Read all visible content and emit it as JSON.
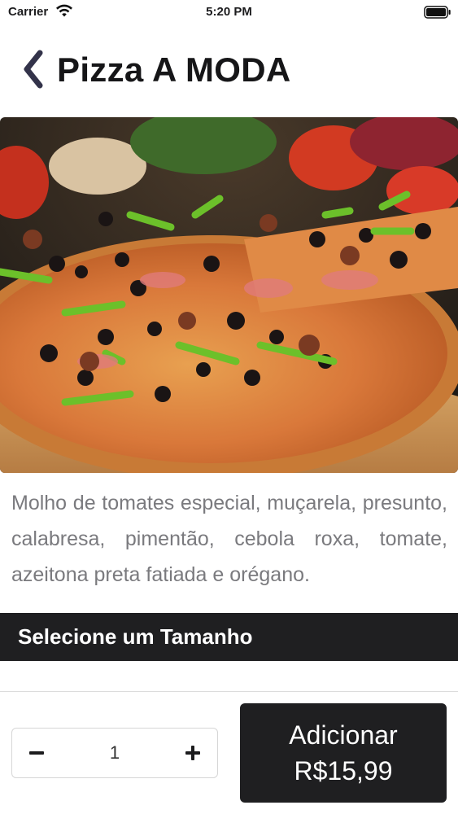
{
  "status_bar": {
    "carrier": "Carrier",
    "time": "5:20 PM"
  },
  "header": {
    "title": "Pizza A MODA",
    "back_icon": "chevron-left-icon"
  },
  "product": {
    "image_description": "pizza-photo",
    "description": "Molho de tomates especial, muçarela, presunto, calabresa, pimentão, cebola roxa, tomate, azeitona preta fatiada e orégano."
  },
  "size_section": {
    "title": "Selecione um Tamanho"
  },
  "footer": {
    "quantity": "1",
    "minus_icon": "minus-icon",
    "plus_icon": "plus-icon",
    "add_label": "Adicionar",
    "price": "R$15,99"
  },
  "colors": {
    "dark": "#1f1f21",
    "text_muted": "#7a7a7e",
    "background": "#ffffff"
  }
}
